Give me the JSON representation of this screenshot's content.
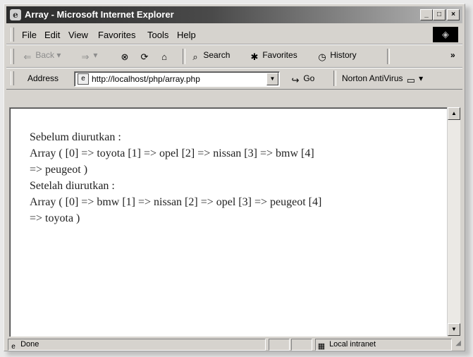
{
  "window": {
    "title": "Array - Microsoft Internet Explorer",
    "minimize_label": "_",
    "maximize_label": "□",
    "close_label": "×"
  },
  "menu": {
    "items": [
      "File",
      "Edit",
      "View",
      "Favorites",
      "Tools",
      "Help"
    ]
  },
  "toolbar": {
    "back_label": "Back",
    "search_label": "Search",
    "favorites_label": "Favorites",
    "history_label": "History",
    "more_label": "»"
  },
  "address": {
    "label": "Address",
    "url": "http://localhost/php/array.php",
    "go_label": "Go",
    "norton_label": "Norton AntiVirus"
  },
  "page": {
    "lines": [
      "Sebelum diurutkan :",
      "Array ( [0] => toyota [1] => opel [2] => nissan [3] => bmw [4]",
      "=> peugeot )",
      "Setelah diurutkan :",
      "Array ( [0] => bmw [1] => nissan [2] => opel [3] => peugeot [4]",
      "=> toyota )"
    ]
  },
  "status": {
    "left_text": "Done",
    "zone_text": "Local intranet"
  },
  "icons": {
    "app": "ie-logo-icon",
    "back": "back-arrow-icon",
    "forward": "forward-arrow-icon",
    "stop": "stop-icon",
    "refresh": "refresh-icon",
    "home": "home-icon",
    "search": "search-icon",
    "favorites": "favorites-icon",
    "history": "history-icon",
    "go": "go-arrow-icon"
  }
}
